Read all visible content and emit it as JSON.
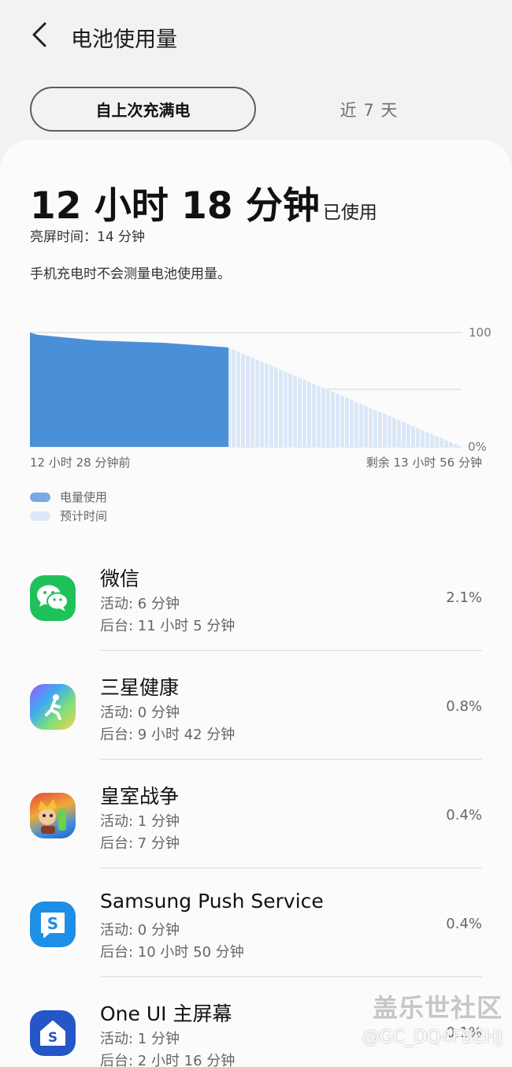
{
  "header": {
    "title": "电池使用量"
  },
  "tabs": [
    {
      "label": "自上次充满电"
    },
    {
      "label": "近 7 天"
    }
  ],
  "summary": {
    "usage_time": "12 小时 18 分钟",
    "usage_suffix": "已使用",
    "screen_time": "亮屏时间：14 分钟",
    "charge_note": "手机充电时不会测量电池使用量。"
  },
  "chart_data": {
    "type": "area",
    "y_tick_labels": [
      "100",
      "0%"
    ],
    "ylim": [
      0,
      100
    ],
    "x_start_label": "12 小时 28 分钟前",
    "x_end_label": "剩余 13 小时 56 分钟",
    "series": [
      {
        "name": "电量使用",
        "color": "#4a90d9",
        "x": [
          0,
          10,
          85,
          170,
          252
        ],
        "y": [
          100,
          98,
          93,
          91,
          87
        ]
      },
      {
        "name": "预计时间",
        "color": "#d8e6f8",
        "x": [
          252,
          548
        ],
        "y": [
          87,
          0
        ]
      }
    ],
    "grid": true
  },
  "legend": [
    {
      "label": "电量使用",
      "color": "#79aae5"
    },
    {
      "label": "预计时间",
      "color": "#dde8f8"
    }
  ],
  "apps": [
    {
      "name": "微信",
      "active": "活动: 6 分钟",
      "background": "后台: 11 小时 5 分钟",
      "percent": "2.1%",
      "icon": "wechat-icon"
    },
    {
      "name": "三星健康",
      "active": "活动: 0 分钟",
      "background": "后台: 9 小时 42 分钟",
      "percent": "0.8%",
      "icon": "samsung-health-icon"
    },
    {
      "name": "皇室战争",
      "active": "活动: 1 分钟",
      "background": "后台: 7 分钟",
      "percent": "0.4%",
      "icon": "clash-royale-icon"
    },
    {
      "name": "Samsung Push Service",
      "active": "活动: 0 分钟",
      "background": "后台: 10 小时 50 分钟",
      "percent": "0.4%",
      "icon": "samsung-push-icon"
    },
    {
      "name": "One UI 主屏幕",
      "active": "活动: 1 分钟",
      "background": "后台: 2 小时 16 分钟",
      "percent": "0.1%",
      "icon": "one-ui-home-icon"
    }
  ],
  "watermark": {
    "brand": "盖乐世社区",
    "user": "@GC_DQ4FBEHJ"
  }
}
